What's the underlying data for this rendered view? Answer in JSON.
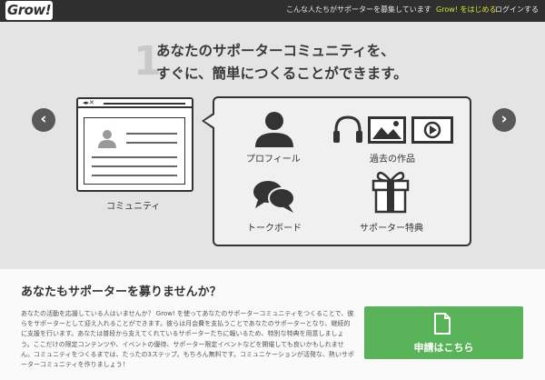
{
  "header": {
    "logo_text": "Grow!",
    "tagline": "こんな人たちがサポーターを募集しています",
    "start_link": "Grow! をはじめる",
    "login_link": "ログインする",
    "start_color": "#d6e43a"
  },
  "hero": {
    "step_number": "1",
    "headline_line1": "あなたのサポーターコミュニティを、",
    "headline_line2": "すぐに、簡単につくることができます。",
    "prev_icon": "chevron-left-icon",
    "next_icon": "chevron-right-icon",
    "prev_glyph": "‹",
    "next_glyph": "›"
  },
  "community": {
    "label": "コミュニティ",
    "window_controls": "◂▸✕"
  },
  "features": [
    {
      "label": "プロフィール",
      "icon": "person-icon"
    },
    {
      "label": "過去の作品",
      "icon": "media-icons"
    },
    {
      "label": "トークボード",
      "icon": "chat-bubbles-icon"
    },
    {
      "label": "サポーター特典",
      "icon": "gift-icon"
    }
  ],
  "lower": {
    "title": "あなたもサポーターを募りませんか？",
    "body": "あなたの活動を応援している人はいませんか？ Grow! を使ってあなたのサポーターコミュニティをつくることで、彼らをサポーターとして迎え入れることができます。彼らは月会費を支払うことであなたのサポーターとなり、継続的に支援を行います。あなたは普段から支えてくれているサポーターたちに報いるため、特別な特典を用意しましょう。ここだけの限定コンテンツや、イベントの優待、サポーター限定イベントなどを開催しても良いかもしれません。コミュニティをつくるまでは、たったの3ステップ。もちろん無料です。コミュニケーションが活発な、熱いサポーターコミュニティを作りましょう！",
    "apply_label": "申請はこちら",
    "apply_color": "#59b358"
  }
}
